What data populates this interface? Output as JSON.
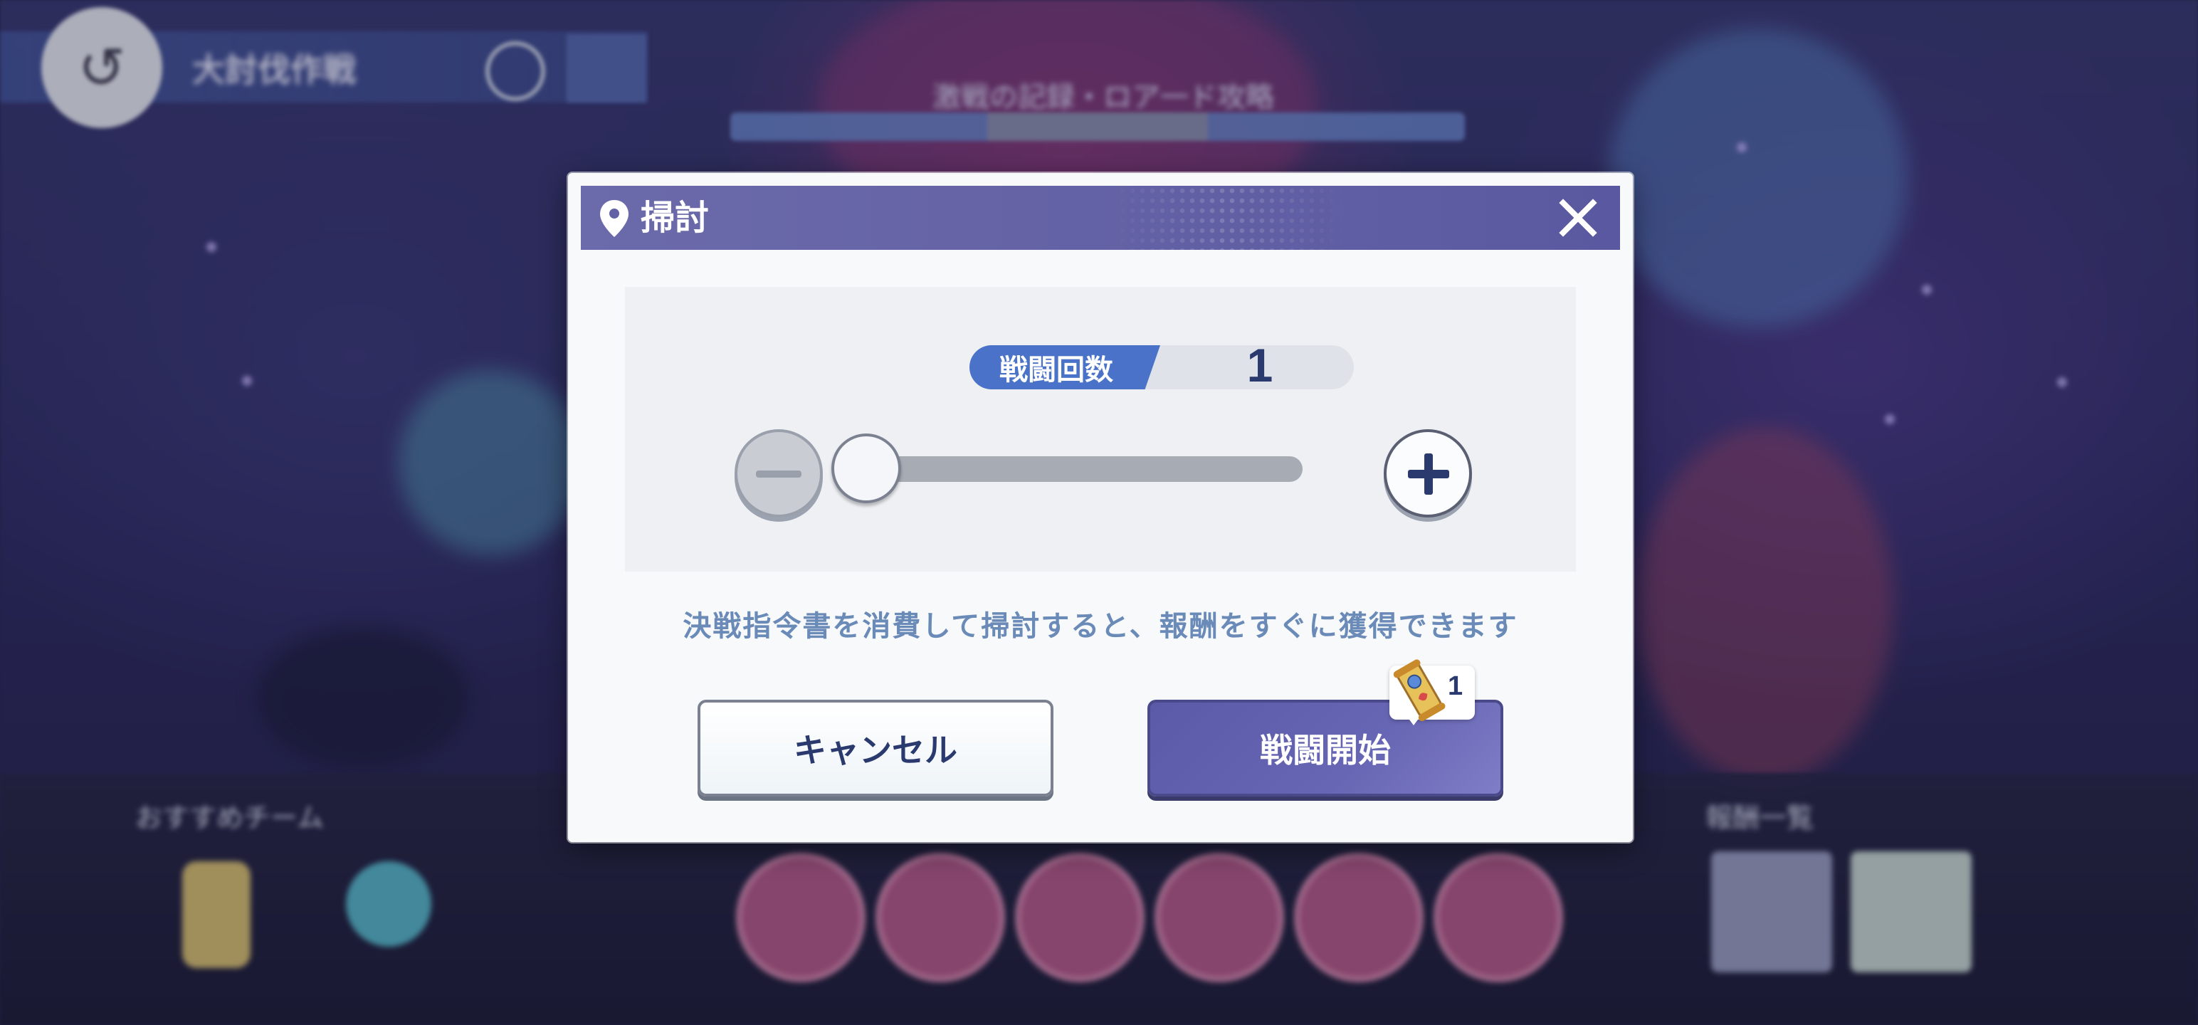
{
  "background": {
    "location_label": "大討伐作戦",
    "progress_label": "激戦の記録・ロア一ド攻略",
    "recommended_team_label": "おすすめチーム",
    "rewards_label": "報酬一覧"
  },
  "dialog": {
    "title": "掃討",
    "battle_count_label": "戦闘回数",
    "battle_count_value": "1",
    "slider_value": 1,
    "message": "決戦指令書を消費して掃討すると、報酬をすぐに獲得できます",
    "cancel_label": "キャンセル",
    "start_label": "戦闘開始",
    "cost_count": "1"
  },
  "colors": {
    "header": "#6361a5",
    "accent_blue": "#4a72c8",
    "text_navy": "#2a3a6e",
    "message": "#6a8ab8"
  },
  "icons": {
    "back": "back-arrow-icon",
    "pin": "location-pin-icon",
    "close": "close-icon",
    "home": "home-icon",
    "ticket": "scroll-ticket-icon"
  }
}
